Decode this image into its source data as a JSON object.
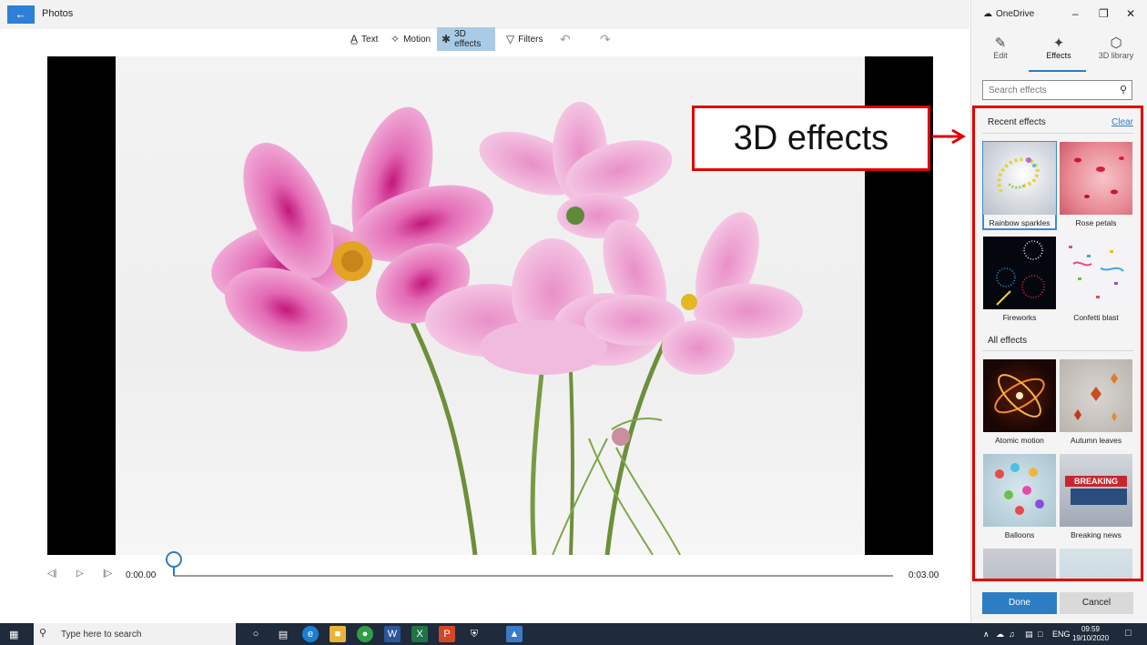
{
  "app": {
    "title": "Photos",
    "back_icon": "back-arrow-icon"
  },
  "toolbar": {
    "items": [
      {
        "label": "Text",
        "icon": "text-icon"
      },
      {
        "label": "Motion",
        "icon": "motion-icon"
      },
      {
        "label": "3D effects",
        "icon": "3d-effects-icon",
        "active": true
      },
      {
        "label": "Filters",
        "icon": "filters-icon"
      }
    ],
    "undo_icon": "undo-icon",
    "redo_icon": "redo-icon"
  },
  "playback": {
    "current_time": "0:00.00",
    "total_time": "0:03.00",
    "progress": 0
  },
  "panel": {
    "window_title": "OneDrive",
    "tabs": [
      {
        "label": "Edit",
        "icon": "pencil-icon"
      },
      {
        "label": "Effects",
        "icon": "effects-icon",
        "active": true
      },
      {
        "label": "3D library",
        "icon": "cube-icon"
      }
    ],
    "search_placeholder": "Search effects",
    "recent_title": "Recent effects",
    "clear_label": "Clear",
    "recent_effects": [
      {
        "label": "Rainbow sparkles",
        "selected": true
      },
      {
        "label": "Rose petals"
      },
      {
        "label": "Fireworks"
      },
      {
        "label": "Confetti blast"
      }
    ],
    "all_title": "All effects",
    "all_effects": [
      {
        "label": "Atomic motion"
      },
      {
        "label": "Autumn leaves"
      },
      {
        "label": "Balloons"
      },
      {
        "label": "Breaking news",
        "thumb_text": "BREAKING NEWS"
      }
    ],
    "done_label": "Done",
    "cancel_label": "Cancel"
  },
  "annotation": {
    "text": "3D effects",
    "color": "#e00000"
  },
  "taskbar": {
    "search_text": "Type here to search",
    "language": "ENG",
    "time": "09:59",
    "date": "19/10/2020"
  },
  "colors": {
    "accent": "#2d7dc4",
    "toolbar_active": "#a8cbe6",
    "annotation": "#e00000",
    "taskbar": "#1f2a3a"
  }
}
